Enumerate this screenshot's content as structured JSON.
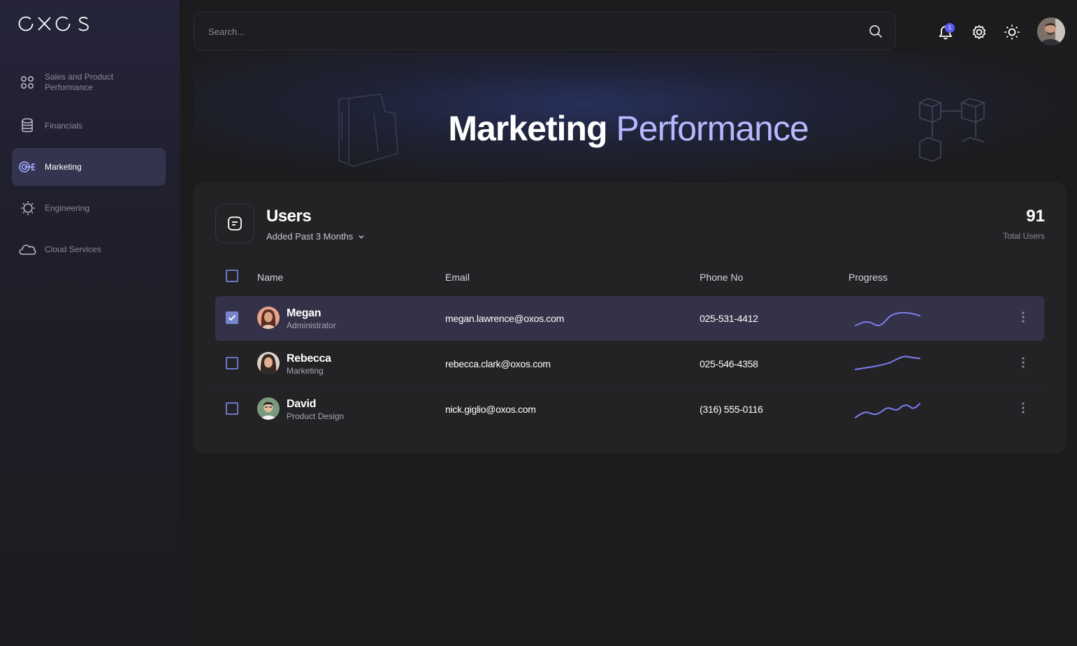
{
  "brand": {
    "logo_text": "OXOS"
  },
  "sidebar": {
    "items": [
      {
        "label": "Sales and Product Performance",
        "icon": "grid-dots-icon"
      },
      {
        "label": "Financials",
        "icon": "database-icon"
      },
      {
        "label": "Marketing",
        "icon": "target-icon",
        "active": true
      },
      {
        "label": "Engineering",
        "icon": "gear-bulb-icon"
      },
      {
        "label": "Cloud Services",
        "icon": "cloud-icon"
      }
    ]
  },
  "header": {
    "search_placeholder": "Search...",
    "notification_count": "1"
  },
  "hero": {
    "title_bold": "Marketing",
    "title_light": "Performance"
  },
  "users_card": {
    "title": "Users",
    "filter_label": "Added Past 3 Months",
    "total_value": "91",
    "total_label": "Total Users",
    "columns": [
      "Name",
      "Email",
      "Phone No",
      "Progress"
    ],
    "rows": [
      {
        "name": "Megan",
        "role": "Administrator",
        "email": "megan.lawrence@oxos.com",
        "phone": "025-531-4412",
        "selected": true
      },
      {
        "name": "Rebecca",
        "role": "Marketing",
        "email": "rebecca.clark@oxos.com",
        "phone": "025-546-4358",
        "selected": false
      },
      {
        "name": "David",
        "role": "Product Design",
        "email": "nick.giglio@oxos.com",
        "phone": "(316) 555-0116",
        "selected": false
      }
    ]
  },
  "colors": {
    "accent": "#7b7ef0",
    "active_nav_bg": "#35344e",
    "card_bg": "#232325",
    "hero_accent_text": "#b8b8ff"
  }
}
